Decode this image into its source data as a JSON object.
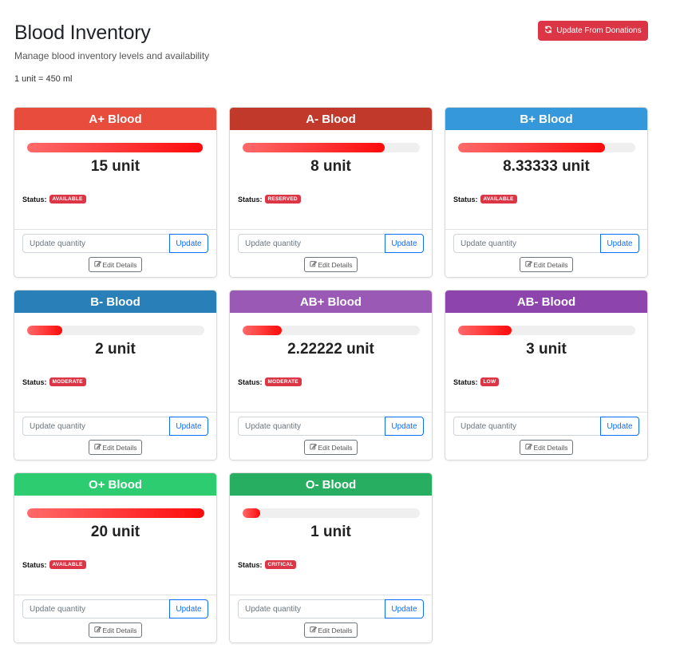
{
  "header": {
    "title": "Blood Inventory",
    "subtitle": "Manage blood inventory levels and availability",
    "unit_note": "1 unit = 450 ml",
    "update_donations_label": "Update From Donations",
    "update_donations_icon": "refresh-icon"
  },
  "colors": {
    "danger": "#dc3545",
    "primary": "#0d6efd",
    "progress_start": "#ff6a6a",
    "progress_end": "#ff0a0a"
  },
  "cards": [
    {
      "title": "A+ Blood",
      "header_color": "#e74c3c",
      "quantity": "15 unit",
      "level": 0.99,
      "status_label": "Status:",
      "status": "AVAILABLE",
      "input_placeholder": "Update quantity",
      "update_label": "Update",
      "edit_label": "Edit Details"
    },
    {
      "title": "A- Blood",
      "header_color": "#c0392b",
      "quantity": "8 unit",
      "level": 0.8,
      "status_label": "Status:",
      "status": "RESERVED",
      "input_placeholder": "Update quantity",
      "update_label": "Update",
      "edit_label": "Edit Details"
    },
    {
      "title": "B+ Blood",
      "header_color": "#3498db",
      "quantity": "8.33333 unit",
      "level": 0.83,
      "status_label": "Status:",
      "status": "AVAILABLE",
      "input_placeholder": "Update quantity",
      "update_label": "Update",
      "edit_label": "Edit Details"
    },
    {
      "title": "B- Blood",
      "header_color": "#2980b9",
      "quantity": "2 unit",
      "level": 0.2,
      "status_label": "Status:",
      "status": "MODERATE",
      "input_placeholder": "Update quantity",
      "update_label": "Update",
      "edit_label": "Edit Details"
    },
    {
      "title": "AB+ Blood",
      "header_color": "#9b59b6",
      "quantity": "2.22222 unit",
      "level": 0.22,
      "status_label": "Status:",
      "status": "MODERATE",
      "input_placeholder": "Update quantity",
      "update_label": "Update",
      "edit_label": "Edit Details"
    },
    {
      "title": "AB- Blood",
      "header_color": "#8e44ad",
      "quantity": "3 unit",
      "level": 0.3,
      "status_label": "Status:",
      "status": "LOW",
      "input_placeholder": "Update quantity",
      "update_label": "Update",
      "edit_label": "Edit Details"
    },
    {
      "title": "O+ Blood",
      "header_color": "#2ecc71",
      "quantity": "20 unit",
      "level": 1.0,
      "status_label": "Status:",
      "status": "AVAILABLE",
      "input_placeholder": "Update quantity",
      "update_label": "Update",
      "edit_label": "Edit Details"
    },
    {
      "title": "O- Blood",
      "header_color": "#27ae60",
      "quantity": "1 unit",
      "level": 0.1,
      "status_label": "Status:",
      "status": "CRITICAL",
      "input_placeholder": "Update quantity",
      "update_label": "Update",
      "edit_label": "Edit Details"
    }
  ]
}
